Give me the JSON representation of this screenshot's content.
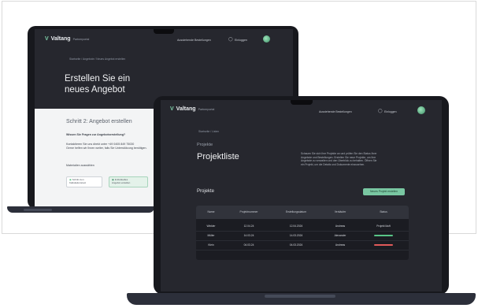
{
  "brand": {
    "logo_glyph": "V",
    "name": "Valtang",
    "sub": "Partnerportal"
  },
  "screen1": {
    "nav": {
      "link": "Ausstehende Bestellungen",
      "login": "Einloggen"
    },
    "breadcrumb": "Startseite  /  Angebote  /  Neues Angebot erstellen",
    "heading_line1": "Erstellen Sie ein",
    "heading_line2": "neues Angebot",
    "panel": {
      "title": "Schritt 2: Angebot erstellen",
      "question": "Wissen Sie Fragen zur Angebotserstellung?",
      "info_line1": "Kontaktieren Sie uns direkt unter +49 0405 849 75030",
      "info_line2": "Gerne helfen wir Ihnen weiter, falls Sie Unterstützung benötigen.",
      "select_label": "Materialien auswählen",
      "btn1_line1": "Schritt zum",
      "btn1_line2": "Kalkulationstool",
      "btn2_line1": "Individuelles",
      "btn2_line2": "Angebot erstellen"
    }
  },
  "screen2": {
    "nav": {
      "link": "Ausstehende Bestellungen",
      "login": "Einloggen"
    },
    "breadcrumb": "Startseite  /  Listen",
    "eyebrow": "Projekte",
    "heading": "Projektliste",
    "description": [
      "Schauen Sie sich Ihre Projekte an und prüfen Sie den Status Ihrer",
      "Angebote und Bestellungen. Erstellen Sie neue Projekte, um Ihre",
      "Angebote zu verwalten und den Überblick zu behalten. Öffnen Sie",
      "ein Projekt, um die Details und Dokumente einzusehen."
    ],
    "section": "Projekte",
    "cta": "Neues Projekt erstellen",
    "table": {
      "headers": [
        "Name",
        "Projektnummer",
        "Erstellungsdatum",
        "Verkäufer",
        "Status"
      ],
      "rows": [
        [
          "Winkler",
          "12.04.24",
          "12.04.2024",
          "Andreas",
          "Projekt läuft"
        ],
        [
          "Müller",
          "14.03.24",
          "14.03.2024",
          "Alexander",
          ""
        ],
        [
          "Klein",
          "04.03.24",
          "04.03.2024",
          "Andreas",
          ""
        ]
      ]
    },
    "status_colors": [
      "#58c486",
      "#e05a5a"
    ]
  }
}
